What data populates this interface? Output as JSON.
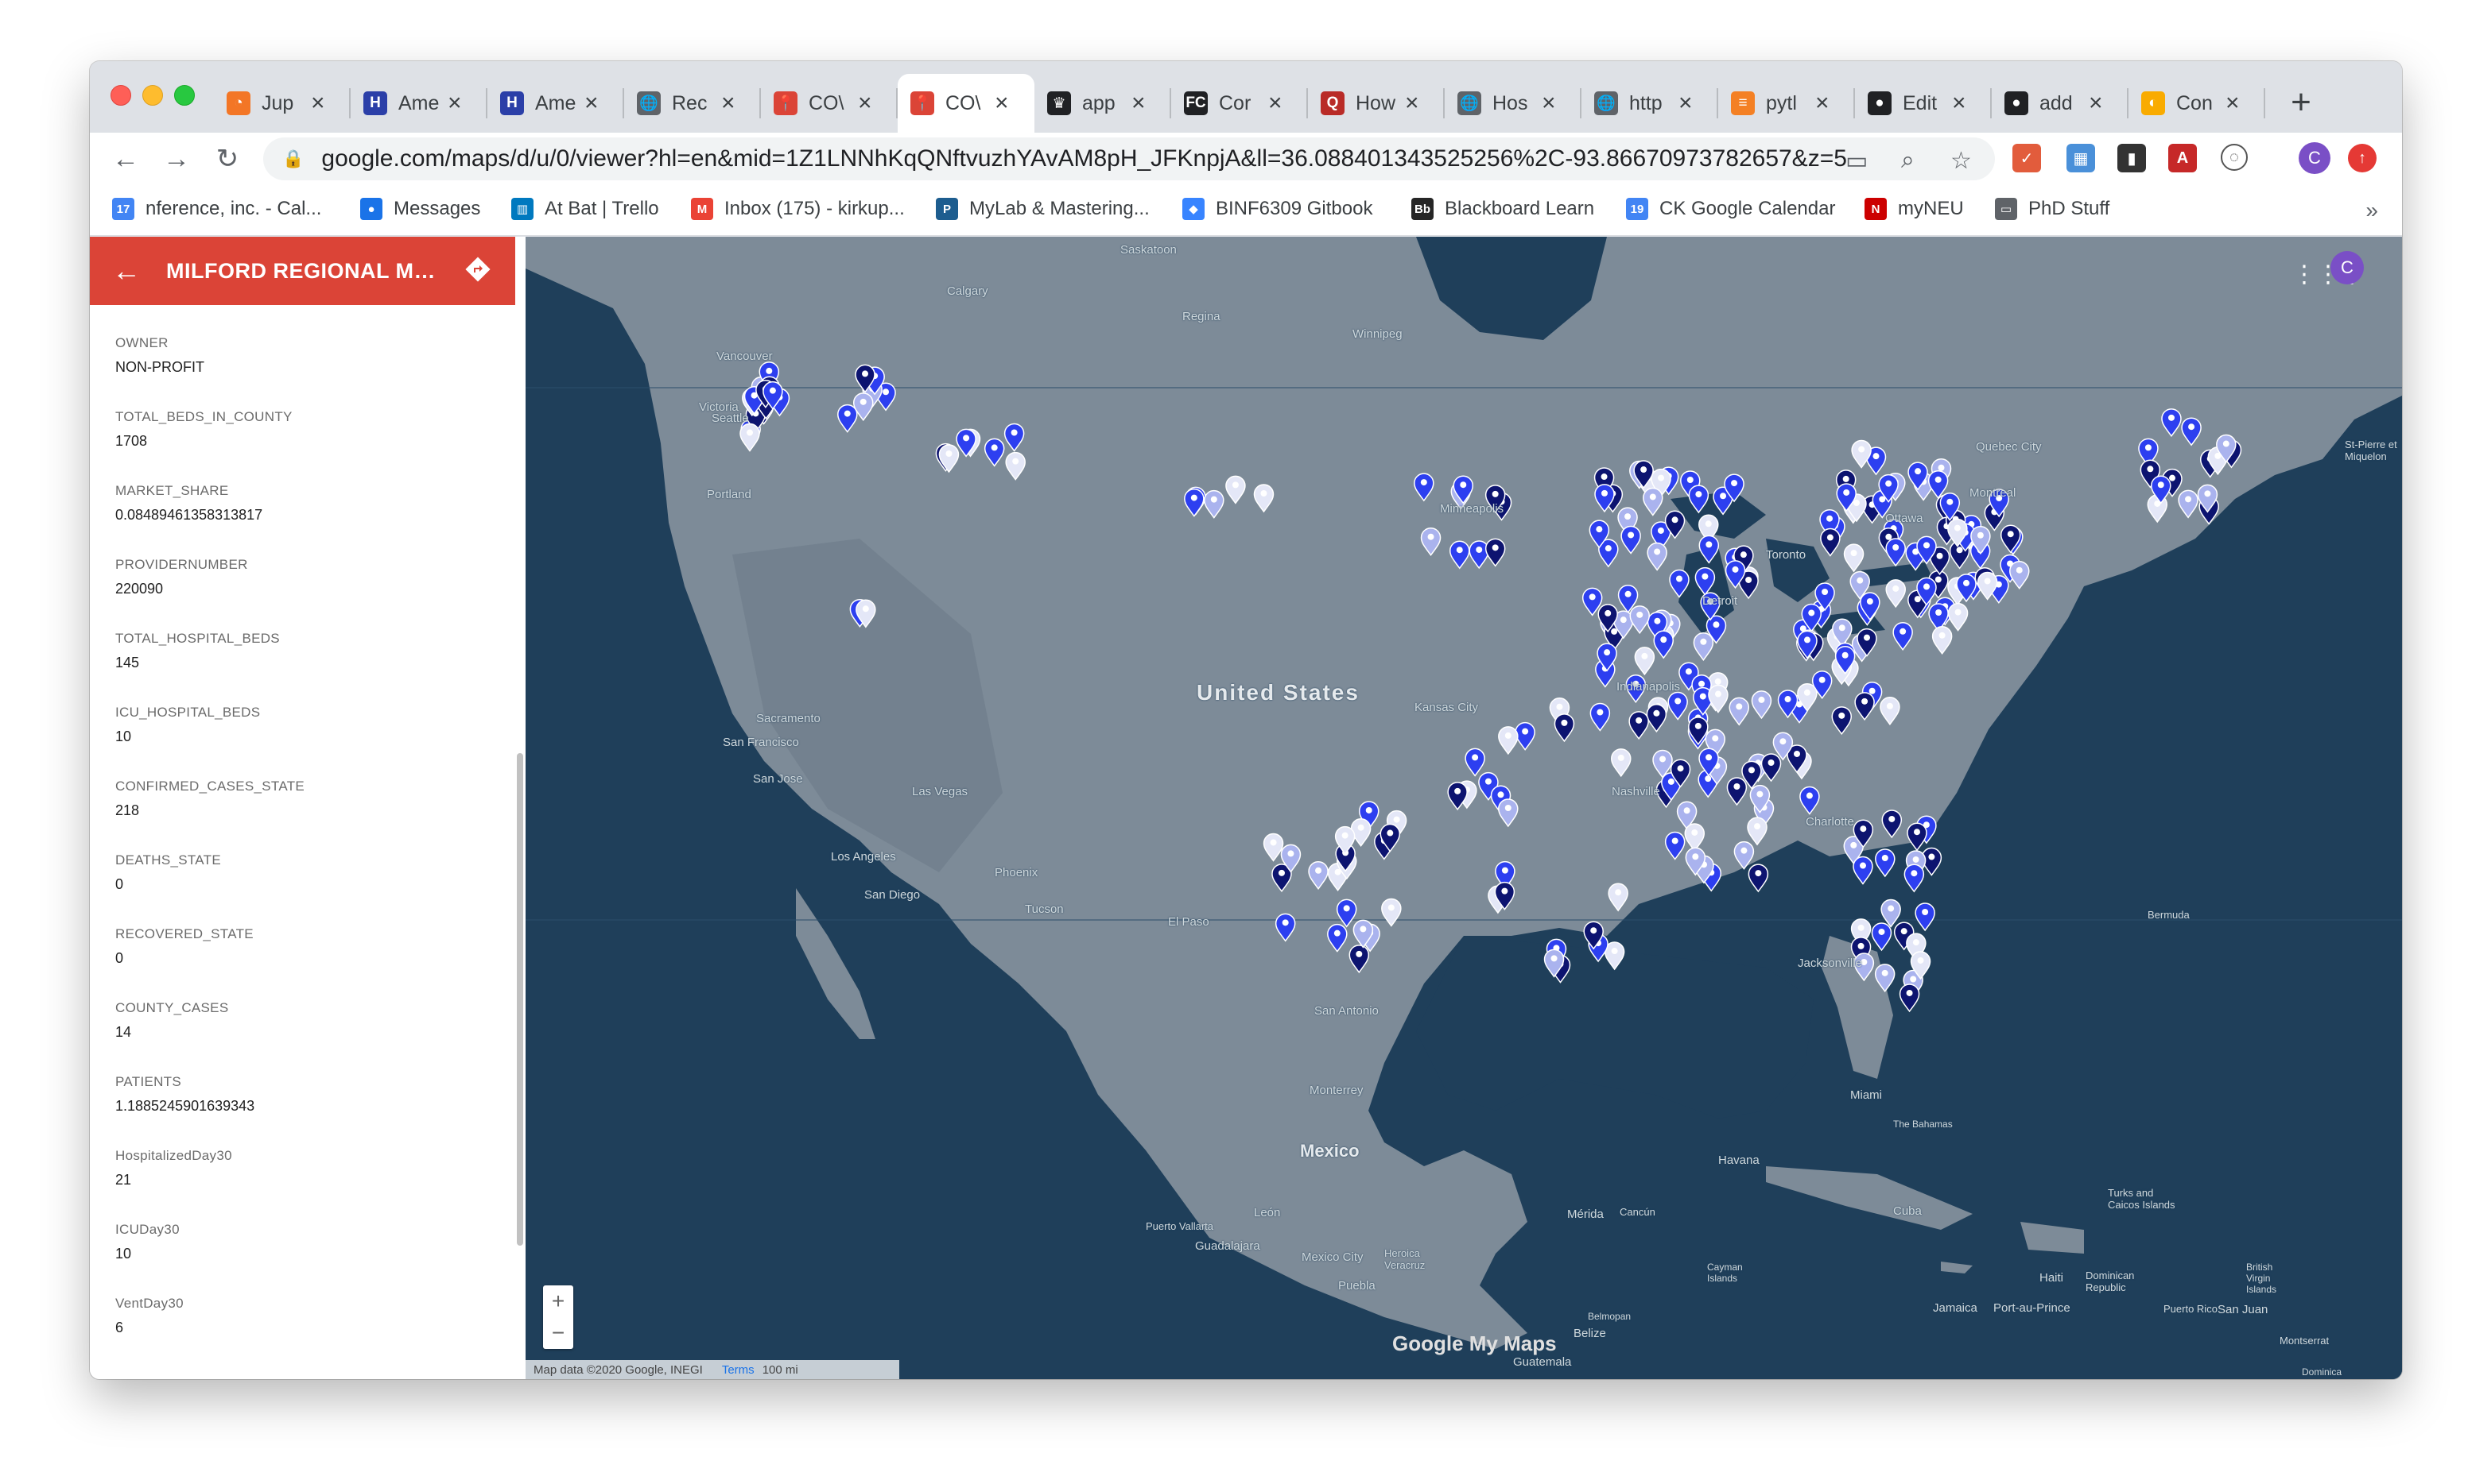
{
  "tabs": [
    {
      "label": "Jup",
      "icon": "jupyter-icon",
      "color": "#f37626",
      "glyph": "◔"
    },
    {
      "label": "Ame",
      "icon": "hospital-h-icon",
      "color": "#2b3fa8",
      "glyph": "H"
    },
    {
      "label": "Ame",
      "icon": "hospital-h-icon",
      "color": "#2b3fa8",
      "glyph": "H"
    },
    {
      "label": "Rec",
      "icon": "globe-icon",
      "color": "#5f6368",
      "glyph": "🌐"
    },
    {
      "label": "CO\\",
      "icon": "my-maps-pin-icon",
      "color": "#db4437",
      "glyph": "📍"
    },
    {
      "label": "CO\\",
      "icon": "my-maps-pin-icon",
      "color": "#db4437",
      "glyph": "📍",
      "active": true
    },
    {
      "label": "app",
      "icon": "crown-icon",
      "color": "#202124",
      "glyph": "♛"
    },
    {
      "label": "Cor",
      "icon": "fc-logo-icon",
      "color": "#202124",
      "glyph": "FC"
    },
    {
      "label": "How",
      "icon": "quora-icon",
      "color": "#b92b27",
      "glyph": "Q"
    },
    {
      "label": "Hos",
      "icon": "globe-icon",
      "color": "#5f6368",
      "glyph": "🌐"
    },
    {
      "label": "http",
      "icon": "globe-icon",
      "color": "#5f6368",
      "glyph": "🌐"
    },
    {
      "label": "pytl",
      "icon": "stackoverflow-icon",
      "color": "#f48024",
      "glyph": "≡"
    },
    {
      "label": "Edit",
      "icon": "github-icon",
      "color": "#202124",
      "glyph": "●"
    },
    {
      "label": "add",
      "icon": "github-icon",
      "color": "#202124",
      "glyph": "●"
    },
    {
      "label": "Con",
      "icon": "colab-icon",
      "color": "#f9ab00",
      "glyph": "◐"
    }
  ],
  "toolbar": {
    "url": "google.com/maps/d/u/0/viewer?hl=en&mid=1Z1LNNhKqQNftvuzhYAvAM8pH_JFKnpjA&ll=36.088401343525256%2C-93.86670973782657&z=5",
    "profile_initial": "C"
  },
  "bookmarks": [
    {
      "label": "nference, inc. - Cal...",
      "icon": "calendar-icon",
      "color": "#4285f4",
      "glyph": "17"
    },
    {
      "label": "Messages",
      "icon": "messages-icon",
      "color": "#1a73e8",
      "glyph": "●"
    },
    {
      "label": "At Bat | Trello",
      "icon": "trello-icon",
      "color": "#0079bf",
      "glyph": "▥"
    },
    {
      "label": "Inbox (175) - kirkup...",
      "icon": "gmail-icon",
      "color": "#ea4335",
      "glyph": "M"
    },
    {
      "label": "MyLab & Mastering...",
      "icon": "pearson-icon",
      "color": "#1d5d8f",
      "glyph": "P"
    },
    {
      "label": "BINF6309 Gitbook",
      "icon": "gitbook-icon",
      "color": "#3884ff",
      "glyph": "◆"
    },
    {
      "label": "Blackboard Learn",
      "icon": "blackboard-icon",
      "color": "#262626",
      "glyph": "Bb"
    },
    {
      "label": "CK Google Calendar",
      "icon": "calendar-icon",
      "color": "#4285f4",
      "glyph": "19"
    },
    {
      "label": "myNEU",
      "icon": "neu-icon",
      "color": "#cc0000",
      "glyph": "N"
    },
    {
      "label": "PhD Stuff",
      "icon": "folder-icon",
      "color": "#5f6368",
      "glyph": "▭"
    }
  ],
  "panel": {
    "title": "MILFORD REGIONAL MEDI...",
    "fields": [
      {
        "key": "OWNER",
        "value": "NON-PROFIT"
      },
      {
        "key": "TOTAL_BEDS_IN_COUNTY",
        "value": "1708"
      },
      {
        "key": "MARKET_SHARE",
        "value": "0.08489461358313817"
      },
      {
        "key": "PROVIDERNUMBER",
        "value": "220090"
      },
      {
        "key": "TOTAL_HOSPITAL_BEDS",
        "value": "145"
      },
      {
        "key": "ICU_HOSPITAL_BEDS",
        "value": "10"
      },
      {
        "key": "CONFIRMED_CASES_STATE",
        "value": "218"
      },
      {
        "key": "DEATHS_STATE",
        "value": "0"
      },
      {
        "key": "RECOVERED_STATE",
        "value": "0"
      },
      {
        "key": "COUNTY_CASES",
        "value": "14"
      },
      {
        "key": "PATIENTS",
        "value": "1.1885245901639343"
      },
      {
        "key": "HospitalizedDay30",
        "value": "21"
      },
      {
        "key": "ICUDay30",
        "value": "10"
      },
      {
        "key": "VentDay30",
        "value": "6"
      }
    ]
  },
  "map": {
    "labels": {
      "saskatoon": "Saskatoon",
      "calgary": "Calgary",
      "regina": "Regina",
      "winnipeg": "Winnipeg",
      "vancouver": "Vancouver",
      "victoria": "Victoria",
      "quebec": "Quebec City",
      "montreal": "Montreal",
      "ottawa": "Ottawa",
      "toronto": "Toronto",
      "stpierre": "St-Pierre et Miquelon",
      "minneapolis": "Minneapolis",
      "us": "United States",
      "sacramento": "Sacramento",
      "sanfrancisco": "San Francisco",
      "sanjose": "San Jose",
      "lasvegas": "Las Vegas",
      "losangeles": "Los Angeles",
      "sandiego": "San Diego",
      "phoenix": "Phoenix",
      "tucson": "Tucson",
      "elpaso": "El Paso",
      "sanantonio": "San Antonio",
      "monterrey": "Monterrey",
      "mexico": "Mexico",
      "havana": "Havana",
      "bermuda": "Bermuda",
      "bahamas": "The Bahamas",
      "cuba": "Cuba",
      "leon": "León",
      "guadalajara": "Guadalajara",
      "puertovallarta": "Puerto Vallarta",
      "mexicocity": "Mexico City",
      "puebla": "Puebla",
      "veracruz": "Heroica Veracruz",
      "merida": "Mérida",
      "cancun": "Cancún",
      "belize": "Belize",
      "guatemala": "Guatemala",
      "cayman": "Cayman Islands",
      "haiti": "Haiti",
      "dominican": "Dominican Republic",
      "jamaica": "Jamaica",
      "portauprince": "Port-au-Prince",
      "puertorico": "Puerto Rico",
      "sanjuan": "San Juan",
      "turks": "Turks and Caicos Islands",
      "bvi": "British Virgin Islands",
      "montserrat": "Montserrat",
      "dominica": "Dominica",
      "charlotte": "Charlotte",
      "nashville": "Nashville",
      "jacksonville": "Jacksonville",
      "miami": "Miami",
      "kansascity": "Kansas City",
      "indianapolis": "Indianapolis",
      "detroit": "Detroit",
      "portland": "Portland",
      "seattle": "Seattle",
      "belmopan": "Belmopan"
    },
    "footer_text": "Map data ©2020 Google, INEGI",
    "terms": "Terms",
    "scale": "100 mi",
    "logo": "Google My Maps",
    "avatar_initial": "C",
    "marker_colors": {
      "dark": "#0d1470",
      "blue": "#2d3ff0",
      "light": "#aab3ee",
      "white": "#e4e7f7"
    }
  }
}
